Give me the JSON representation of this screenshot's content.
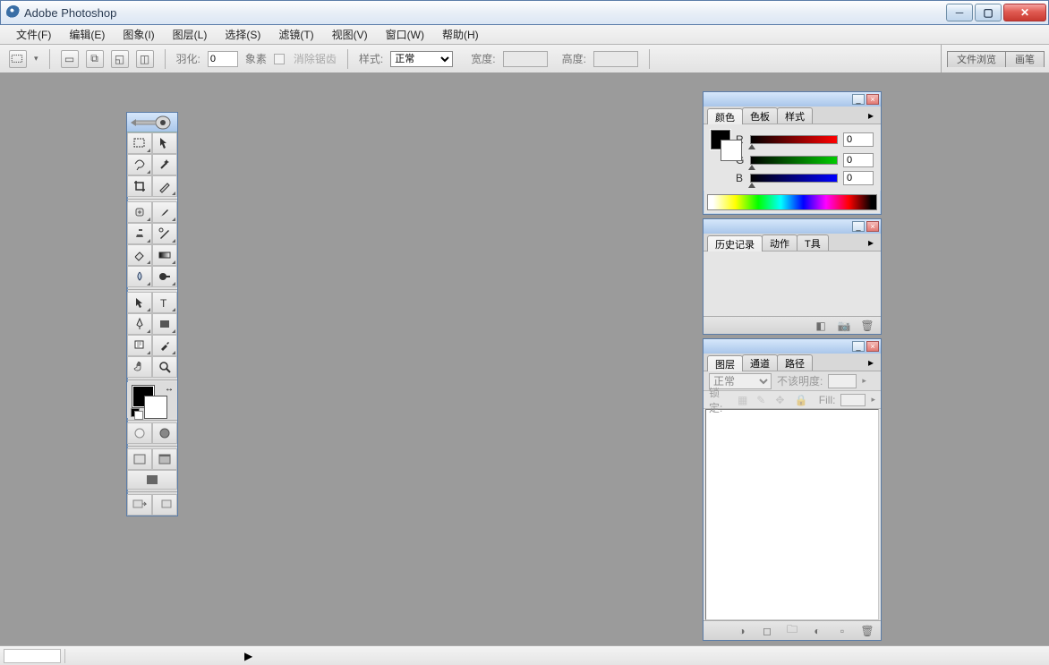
{
  "title": "Adobe Photoshop",
  "menu": [
    "文件(F)",
    "编辑(E)",
    "图象(I)",
    "图层(L)",
    "选择(S)",
    "滤镜(T)",
    "视图(V)",
    "窗口(W)",
    "帮助(H)"
  ],
  "options": {
    "feather_label": "羽化:",
    "feather_value": "0",
    "feather_unit": "象素",
    "antialias_label": "消除锯齿",
    "style_label": "样式:",
    "style_value": "正常",
    "width_label": "宽度:",
    "height_label": "高度:",
    "dock_tabs": [
      "文件浏览",
      "画笔"
    ]
  },
  "toolbox": {
    "tools": [
      "marquee",
      "move",
      "lasso",
      "magic-wand",
      "crop",
      "slice",
      "healing-brush",
      "brush",
      "clone-stamp",
      "history-brush",
      "eraser",
      "gradient",
      "blur",
      "dodge",
      "path-select",
      "type",
      "pen",
      "shape",
      "notes",
      "eyedropper",
      "hand",
      "zoom"
    ]
  },
  "color_panel": {
    "tabs": [
      "颜色",
      "色板",
      "样式"
    ],
    "channels": [
      {
        "label": "R",
        "value": "0"
      },
      {
        "label": "G",
        "value": "0"
      },
      {
        "label": "B",
        "value": "0"
      }
    ]
  },
  "history_panel": {
    "tabs": [
      "历史记录",
      "动作",
      "T具"
    ]
  },
  "layers_panel": {
    "tabs": [
      "图层",
      "通道",
      "路径"
    ],
    "blend_value": "正常",
    "opacity_label": "不该明度:",
    "lock_label": "锁定:",
    "fill_label": "Fill:"
  }
}
